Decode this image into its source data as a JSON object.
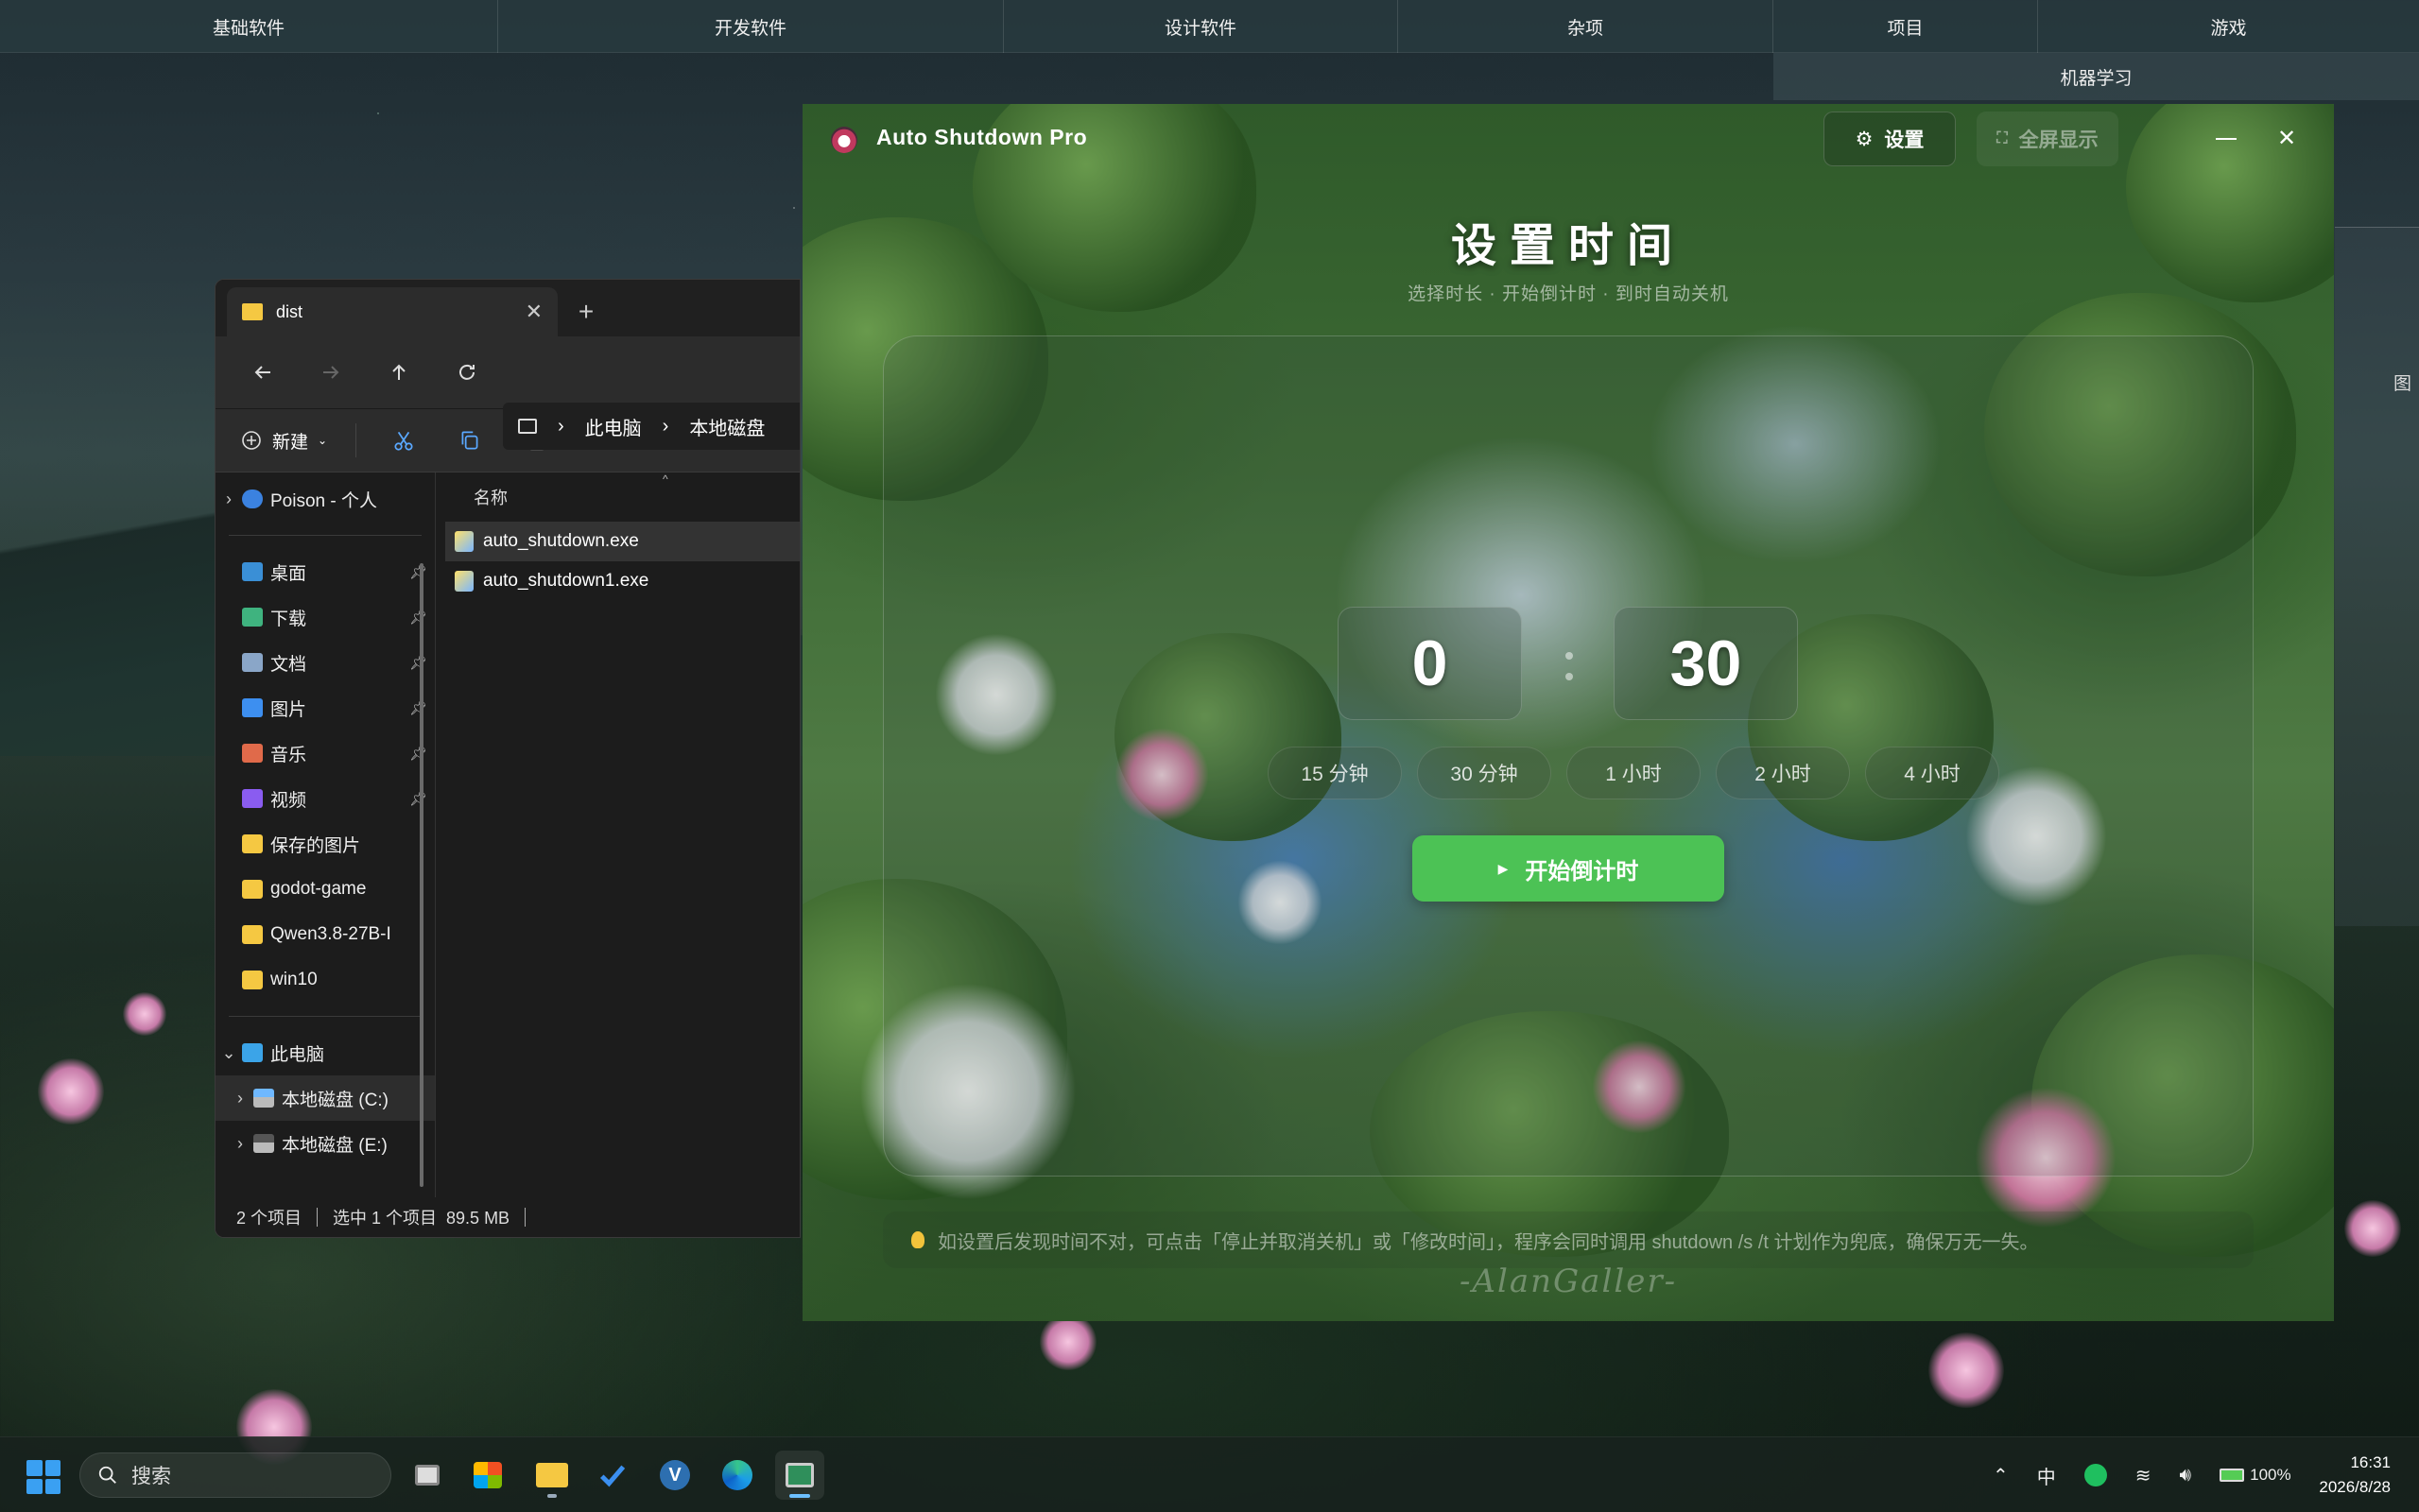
{
  "desktop": {
    "top_folders": [
      "基础软件",
      "开发软件",
      "设计软件",
      "杂项",
      "项目",
      "游戏"
    ],
    "sub_folder": "机器学习",
    "side_label": "图"
  },
  "explorer": {
    "tab_title": "dist",
    "breadcrumb": [
      "此电脑",
      "本地磁盘"
    ],
    "cmd_new": "新建",
    "column_name": "名称",
    "nav_cloud": "Poison - 个人",
    "quick_access": [
      {
        "label": "桌面",
        "icon": "desktop-icon",
        "color": "#3a8fd6"
      },
      {
        "label": "下载",
        "icon": "download-icon",
        "color": "#3fb37f"
      },
      {
        "label": "文档",
        "icon": "documents-icon",
        "color": "#8aa6c8"
      },
      {
        "label": "图片",
        "icon": "pictures-icon",
        "color": "#3d8ff0"
      },
      {
        "label": "音乐",
        "icon": "music-icon",
        "color": "#e06a4a"
      },
      {
        "label": "视频",
        "icon": "videos-icon",
        "color": "#8a5cf0"
      },
      {
        "label": "保存的图片",
        "icon": "folder-icon",
        "color": "#f5c842"
      },
      {
        "label": "godot-game",
        "icon": "folder-icon",
        "color": "#f5c842"
      },
      {
        "label": "Qwen3.8-27B-I",
        "icon": "folder-icon",
        "color": "#f5c842"
      },
      {
        "label": "win10",
        "icon": "folder-icon",
        "color": "#f5c842"
      }
    ],
    "this_pc": "此电脑",
    "drives": [
      "本地磁盘 (C:)",
      "本地磁盘 (E:)"
    ],
    "files": [
      {
        "name": "auto_shutdown.exe",
        "selected": true
      },
      {
        "name": "auto_shutdown1.exe",
        "selected": false
      }
    ],
    "status": {
      "count": "2 个项目",
      "selection": "选中 1 个项目  89.5 MB"
    }
  },
  "app": {
    "title": "Auto Shutdown Pro",
    "settings_label": "设置",
    "fullscreen_label": "全屏显示",
    "heading": "设置时间",
    "subheading": "选择时长 · 开始倒计时 · 到时自动关机",
    "hours": "0",
    "minutes": "30",
    "presets": [
      "15 分钟",
      "30 分钟",
      "1 小时",
      "2 小时",
      "4 小时"
    ],
    "start_label": "开始倒计时",
    "tip": "如设置后发现时间不对，可点击「停止并取消关机」或「修改时间」，程序会同时调用 shutdown /s /t 计划作为兜底，确保万无一失。",
    "watermark": "-AlanGaller-",
    "accent": "#4cc255"
  },
  "taskbar": {
    "search_placeholder": "搜索",
    "tray": {
      "ime": "中",
      "battery": "100%"
    },
    "time": "16:31",
    "date": "2026/8/28"
  }
}
